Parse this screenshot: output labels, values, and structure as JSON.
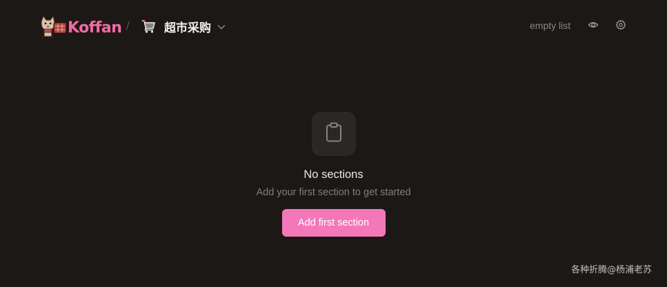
{
  "header": {
    "logo_text": "Koffan",
    "separator": "/",
    "list": {
      "icon": "shopping-cart-icon",
      "name": "超市采购"
    },
    "status_text": "empty list",
    "icons": [
      "eye-icon",
      "gear-icon"
    ]
  },
  "empty_state": {
    "icon": "clipboard-icon",
    "title": "No sections",
    "subtitle": "Add your first section to get started",
    "button_label": "Add first section"
  },
  "watermark": "各种折腾@杨浦老苏",
  "colors": {
    "background": "#1c1816",
    "accent": "#f478b9",
    "logo": "#ef6aa3"
  }
}
